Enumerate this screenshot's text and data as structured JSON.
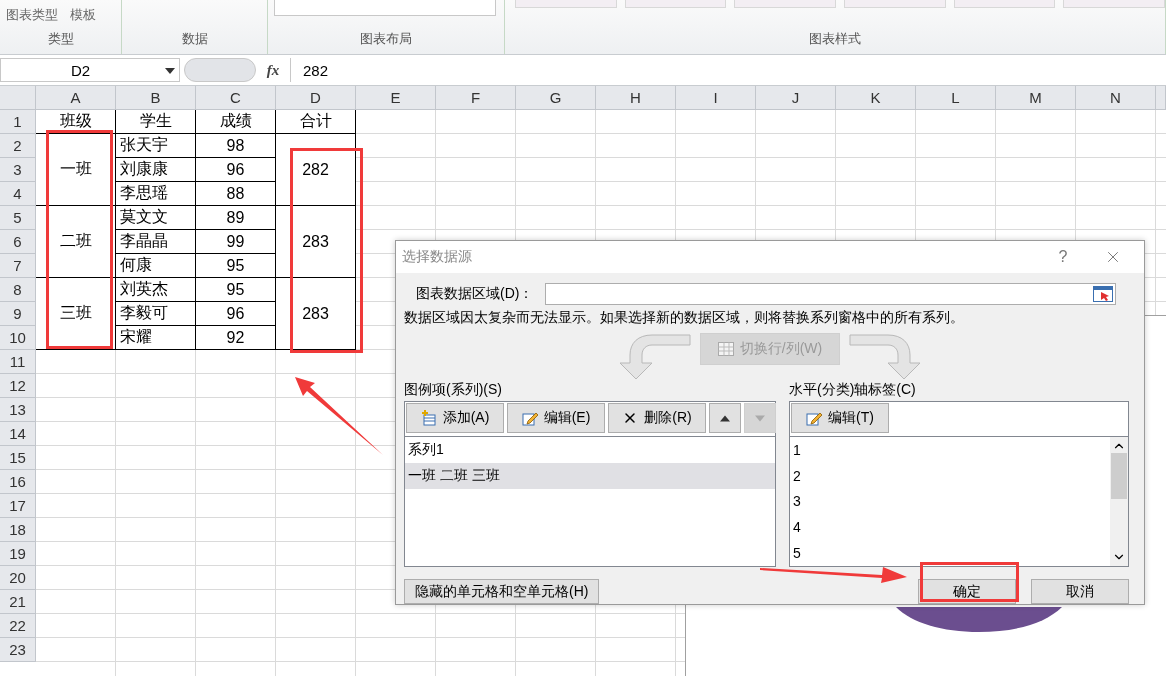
{
  "ribbon": {
    "gallery_items": [
      "图表类型",
      "模板"
    ],
    "groups": [
      "类型",
      "数据",
      "图表布局",
      "图表样式"
    ]
  },
  "formula_bar": {
    "name_box": "D2",
    "fx": "fx",
    "value": "282"
  },
  "sheet": {
    "columns": [
      "A",
      "B",
      "C",
      "D",
      "E",
      "F",
      "G",
      "H",
      "I",
      "J",
      "K",
      "L",
      "M",
      "N"
    ],
    "row_numbers": [
      "1",
      "2",
      "3",
      "4",
      "5",
      "6",
      "7",
      "8",
      "9",
      "10",
      "11",
      "12",
      "13",
      "14",
      "15",
      "16",
      "17",
      "18",
      "19",
      "20",
      "21",
      "22",
      "23"
    ],
    "header": [
      "班级",
      "学生",
      "成绩",
      "合计"
    ],
    "groups": [
      {
        "class": "一班",
        "total": "282",
        "students": [
          {
            "name": "张天宇",
            "score": "98"
          },
          {
            "name": "刘康康",
            "score": "96"
          },
          {
            "name": "李思瑶",
            "score": "88"
          }
        ]
      },
      {
        "class": "二班",
        "total": "283",
        "students": [
          {
            "name": "莫文文",
            "score": "89"
          },
          {
            "name": "李晶晶",
            "score": "99"
          },
          {
            "name": "何康",
            "score": "95"
          }
        ]
      },
      {
        "class": "三班",
        "total": "283",
        "students": [
          {
            "name": "刘英杰",
            "score": "95"
          },
          {
            "name": "李毅可",
            "score": "96"
          },
          {
            "name": "宋耀",
            "score": "92"
          }
        ]
      }
    ]
  },
  "dialog": {
    "title": "选择数据源",
    "help": "?",
    "range_label": "图表数据区域(D)：",
    "info": "数据区域因太复杂而无法显示。如果选择新的数据区域，则将替换系列窗格中的所有系列。",
    "switch_button": {
      "label": "切换行/列(W)",
      "disabled": true
    },
    "series_panel": {
      "label": "图例项(系列)(S)",
      "buttons": [
        {
          "kind": "add",
          "label": "添加(A)"
        },
        {
          "kind": "edit",
          "label": "编辑(E)"
        },
        {
          "kind": "delete",
          "label": "删除(R)"
        },
        {
          "kind": "up",
          "disabled": false
        },
        {
          "kind": "down",
          "disabled": true
        }
      ],
      "items": [
        {
          "label": "系列1",
          "selected": false
        },
        {
          "label": "一班 二班 三班",
          "selected": true
        }
      ]
    },
    "axis_panel": {
      "label": "水平(分类)轴标签(C)",
      "buttons": [
        {
          "kind": "edit",
          "label": "编辑(T)"
        }
      ],
      "items": [
        "1",
        "2",
        "3",
        "4",
        "5"
      ]
    },
    "hidden_button": "隐藏的单元格和空单元格(H)",
    "ok": "确定",
    "cancel": "取消"
  }
}
